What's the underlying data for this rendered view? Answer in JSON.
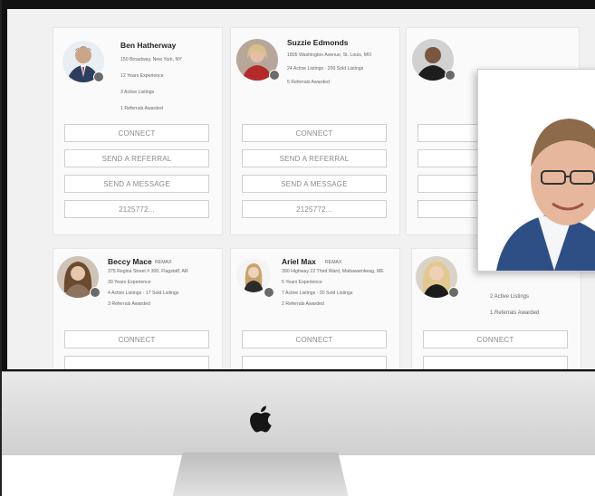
{
  "cards": [
    {
      "name": "Ben Hatherway",
      "address": "150 Broadway, New York, NY",
      "experience": "12 Years Experience",
      "listings": "3 Active Listings",
      "referrals": "1 Referrals Awarded",
      "connect": "CONNECT",
      "referral": "SEND A REFERRAL",
      "message": "SEND A MESSAGE",
      "phone": "2125772..."
    },
    {
      "name": "Suzzie Edmonds",
      "address": "1805 Washington Avenue, St. Louis, MO",
      "listings": "24 Active Listings · 200 Sold Listings",
      "referrals": "5 Referrals Awarded",
      "connect": "CONNECT",
      "referral": "SEND A REFERRAL",
      "message": "SEND A MESSAGE",
      "phone": "2125772..."
    },
    {
      "name": "Beccy Mace",
      "tag": "REMAX",
      "address": "375 Regina Street # 300, Flagstaff, AR",
      "experience": "30 Years Experience",
      "listings": "4 Active Listings · 17 Sold Listings",
      "referrals": "3 Referrals Awarded",
      "connect": "CONNECT"
    },
    {
      "name": "Ariel Max",
      "tag": "REMAX",
      "address": "390 Highway 22 Third Ward, Mattawamkeag, ME",
      "experience": "5 Years Experience",
      "listings": "7 Active Listings · 30 Sold Listings",
      "referrals": "2 Referrals Awarded",
      "connect": "CONNECT"
    },
    {
      "listings": "2 Active Listings",
      "referrals": "1 Referrals Awarded",
      "connect": "CONNECT"
    }
  ],
  "colors": {
    "screen_bg": "#f1f1f1",
    "card_bg": "#fafafa",
    "button_text": "#8a8a8a",
    "bezel": "#111111"
  },
  "icons": {
    "apple": "apple-logo-icon",
    "verified": "verified-badge-icon"
  }
}
